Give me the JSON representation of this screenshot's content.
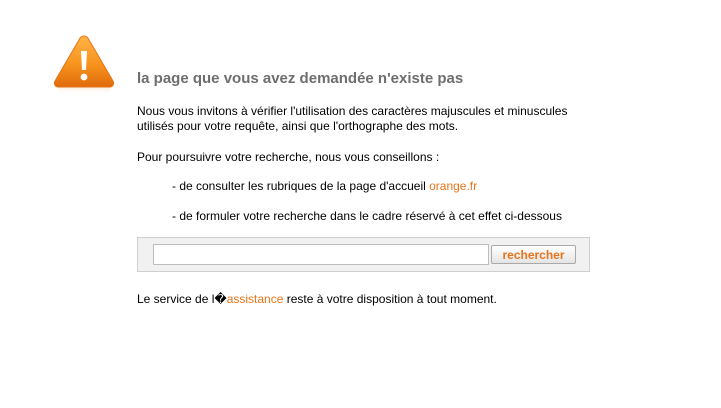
{
  "icons": {
    "warning": "warning-triangle-icon"
  },
  "colors": {
    "accent": "#e8741a",
    "heading": "#6e6e6e",
    "icon_orange": "#f7941d"
  },
  "error": {
    "title": "la page que vous avez demandée n'existe pas",
    "intro": "Nous vous invitons à vérifier l'utilisation des caractères majuscules et minuscules utilisés pour votre requête, ainsi que l'orthographe des mots.",
    "advice": "Pour poursuivre votre recherche, nous vous conseillons :"
  },
  "suggestions": {
    "home_prefix": "- de consulter les rubriques de la page d'accueil ",
    "home_link": "orange.fr",
    "search_text": "- de formuler votre recherche dans le cadre réservé à cet effet ci-dessous"
  },
  "search": {
    "value": "",
    "placeholder": "",
    "button_label": "rechercher"
  },
  "footer": {
    "prefix": "Le service de l�",
    "link": "assistance",
    "suffix": " reste à votre disposition à tout moment."
  }
}
